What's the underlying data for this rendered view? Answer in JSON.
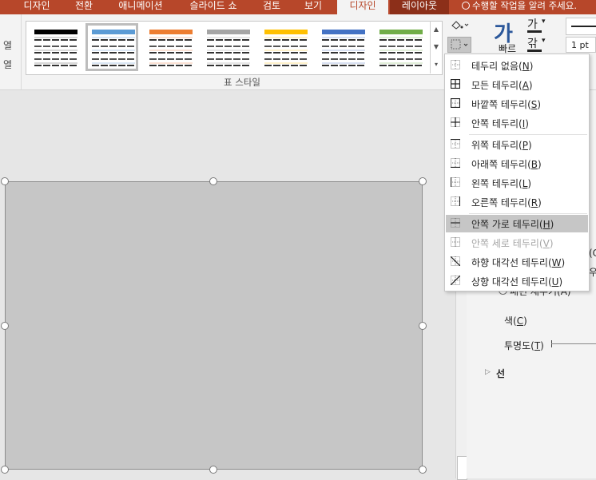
{
  "tabs": [
    "디자인",
    "전환",
    "애니메이션",
    "슬라이드 쇼",
    "검토",
    "보기",
    "디자인",
    "레이아웃"
  ],
  "tell_me": "수행할 작업을 알려 주세요.",
  "left_group": {
    "labels": [
      "열",
      "열"
    ]
  },
  "table_styles": {
    "group_label": "표 스타일",
    "thumbs": [
      {
        "color": "#000000",
        "tint": "#d9d9d9"
      },
      {
        "color": "#5b9bd5",
        "tint": "#dbe7f5"
      },
      {
        "color": "#ed7d31",
        "tint": "#fbe2d5"
      },
      {
        "color": "#a5a5a5",
        "tint": "#e7e7e7"
      },
      {
        "color": "#ffc000",
        "tint": "#fff2cc"
      },
      {
        "color": "#4472c4",
        "tint": "#d9e1f2"
      },
      {
        "color": "#70ad47",
        "tint": "#e2efda"
      }
    ],
    "selected_index": 1
  },
  "ribbon_right": {
    "big_glyph": "가",
    "big_caption": "빠르",
    "ga1": "가",
    "ga2": "갂",
    "pt_value": "1 pt"
  },
  "border_menu": {
    "items": [
      {
        "label": "테두리 없음",
        "key": "N",
        "icon": "border-none-icon"
      },
      {
        "label": "모든 테두리",
        "key": "A",
        "icon": "border-all-icon"
      },
      {
        "label": "바깥쪽 테두리",
        "key": "S",
        "icon": "border-outside-icon"
      },
      {
        "label": "안쪽 테두리",
        "key": "I",
        "icon": "border-inside-icon"
      },
      {
        "label": "위쪽 테두리",
        "key": "P",
        "icon": "border-top-icon"
      },
      {
        "label": "아래쪽 테두리",
        "key": "B",
        "icon": "border-bottom-icon"
      },
      {
        "label": "왼쪽 테두리",
        "key": "L",
        "icon": "border-left-icon"
      },
      {
        "label": "오른쪽 테두리",
        "key": "R",
        "icon": "border-right-icon"
      },
      {
        "label": "안쪽 가로 테두리",
        "key": "H",
        "icon": "border-inside-horizontal-icon"
      },
      {
        "label": "안쪽 세로 테두리",
        "key": "V",
        "icon": "border-inside-vertical-icon"
      },
      {
        "label": "하향 대각선 테두리",
        "key": "W",
        "icon": "border-diagonal-down-icon"
      },
      {
        "label": "상향 대각선 테두리",
        "key": "U",
        "icon": "border-diagonal-up-icon"
      }
    ],
    "highlighted_index": 8,
    "disabled_index": 9
  },
  "format_pane": {
    "partial_c": "(C",
    "partial_u": "우",
    "partial_radio": "패턴 채우기(A)",
    "color_label": "색",
    "color_key": "C",
    "transparency_label": "투명도",
    "transparency_key": "T",
    "line_section": "선"
  }
}
